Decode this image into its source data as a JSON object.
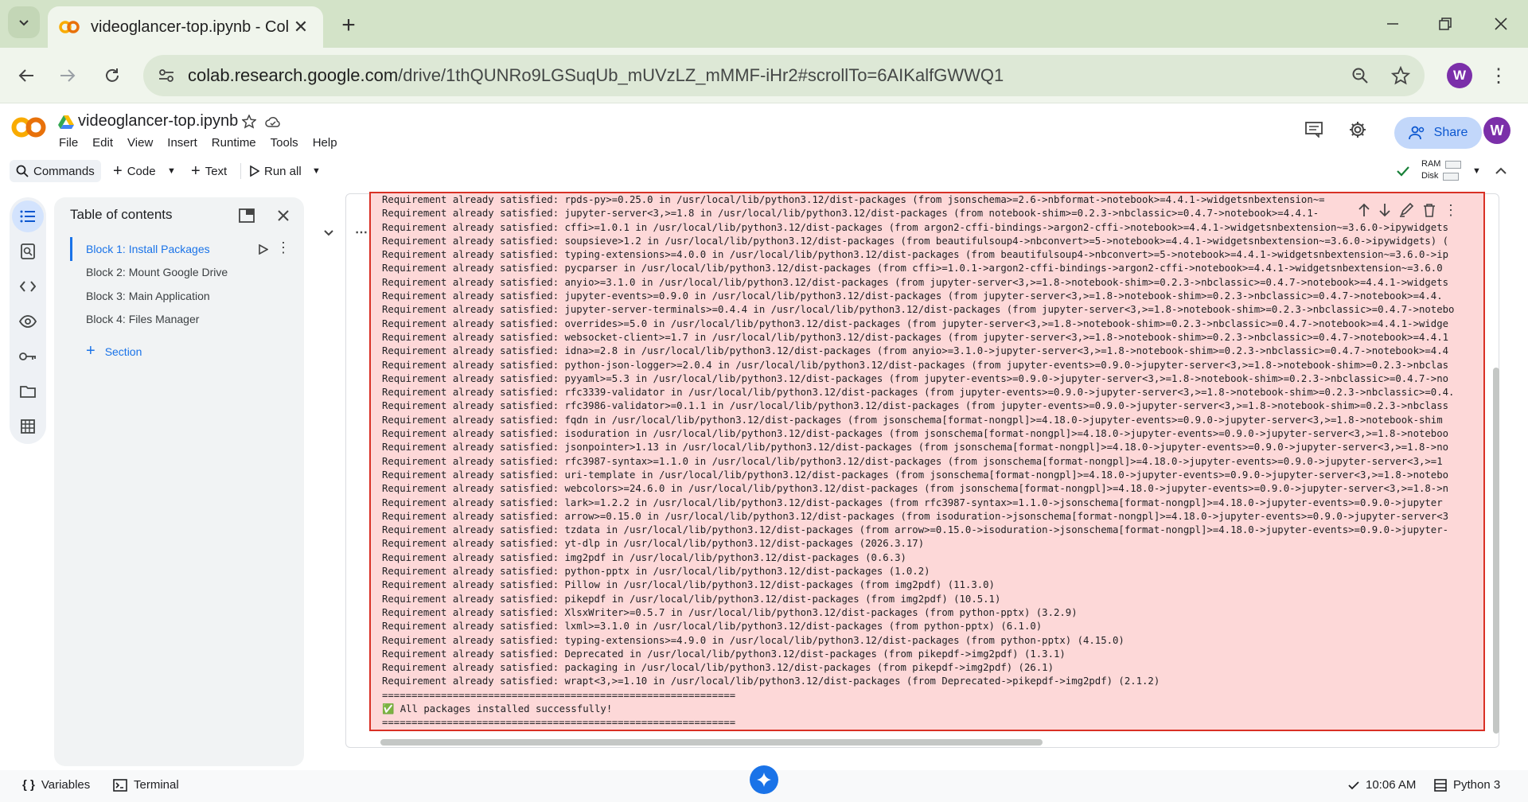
{
  "browser": {
    "tab_title": "videoglancer-top.ipynb - Colab",
    "url_host": "colab.research.google.com",
    "url_path": "/drive/1thQUNRo9LGSuqUb_mUVzLZ_mMMF-iHr2#scrollTo=6AIKalfGWWQ1",
    "profile_initial": "W"
  },
  "colab": {
    "doc_title": "videoglancer-top.ipynb",
    "menu": [
      "File",
      "Edit",
      "View",
      "Insert",
      "Runtime",
      "Tools",
      "Help"
    ],
    "share_label": "Share",
    "user_initial": "W",
    "toolbar": {
      "commands": "Commands",
      "code": "Code",
      "text": "Text",
      "run_all": "Run all",
      "ram": "RAM",
      "disk": "Disk"
    }
  },
  "toc": {
    "title": "Table of contents",
    "items": [
      "Block 1: Install Packages",
      "Block 2: Mount Google Drive",
      "Block 3: Main Application",
      "Block 4: Files Manager"
    ],
    "add_section": "Section"
  },
  "output": {
    "lines": [
      "Requirement already satisfied: rpds-py>=0.25.0 in /usr/local/lib/python3.12/dist-packages (from jsonschema>=2.6->nbformat->notebook>=4.4.1->widgetsnbextension~=",
      "Requirement already satisfied: jupyter-server<3,>=1.8 in /usr/local/lib/python3.12/dist-packages (from notebook-shim>=0.2.3->nbclassic>=0.4.7->notebook>=4.4.1-",
      "Requirement already satisfied: cffi>=1.0.1 in /usr/local/lib/python3.12/dist-packages (from argon2-cffi-bindings->argon2-cffi->notebook>=4.4.1->widgetsnbextension~=3.6.0->ipywidgets",
      "Requirement already satisfied: soupsieve>1.2 in /usr/local/lib/python3.12/dist-packages (from beautifulsoup4->nbconvert>=5->notebook>=4.4.1->widgetsnbextension~=3.6.0->ipywidgets) (",
      "Requirement already satisfied: typing-extensions>=4.0.0 in /usr/local/lib/python3.12/dist-packages (from beautifulsoup4->nbconvert>=5->notebook>=4.4.1->widgetsnbextension~=3.6.0->ip",
      "Requirement already satisfied: pycparser in /usr/local/lib/python3.12/dist-packages (from cffi>=1.0.1->argon2-cffi-bindings->argon2-cffi->notebook>=4.4.1->widgetsnbextension~=3.6.0",
      "Requirement already satisfied: anyio>=3.1.0 in /usr/local/lib/python3.12/dist-packages (from jupyter-server<3,>=1.8->notebook-shim>=0.2.3->nbclassic>=0.4.7->notebook>=4.4.1->widgets",
      "Requirement already satisfied: jupyter-events>=0.9.0 in /usr/local/lib/python3.12/dist-packages (from jupyter-server<3,>=1.8->notebook-shim>=0.2.3->nbclassic>=0.4.7->notebook>=4.4.",
      "Requirement already satisfied: jupyter-server-terminals>=0.4.4 in /usr/local/lib/python3.12/dist-packages (from jupyter-server<3,>=1.8->notebook-shim>=0.2.3->nbclassic>=0.4.7->notebo",
      "Requirement already satisfied: overrides>=5.0 in /usr/local/lib/python3.12/dist-packages (from jupyter-server<3,>=1.8->notebook-shim>=0.2.3->nbclassic>=0.4.7->notebook>=4.4.1->widge",
      "Requirement already satisfied: websocket-client>=1.7 in /usr/local/lib/python3.12/dist-packages (from jupyter-server<3,>=1.8->notebook-shim>=0.2.3->nbclassic>=0.4.7->notebook>=4.4.1",
      "Requirement already satisfied: idna>=2.8 in /usr/local/lib/python3.12/dist-packages (from anyio>=3.1.0->jupyter-server<3,>=1.8->notebook-shim>=0.2.3->nbclassic>=0.4.7->notebook>=4.4",
      "Requirement already satisfied: python-json-logger>=2.0.4 in /usr/local/lib/python3.12/dist-packages (from jupyter-events>=0.9.0->jupyter-server<3,>=1.8->notebook-shim>=0.2.3->nbclas",
      "Requirement already satisfied: pyyaml>=5.3 in /usr/local/lib/python3.12/dist-packages (from jupyter-events>=0.9.0->jupyter-server<3,>=1.8->notebook-shim>=0.2.3->nbclassic>=0.4.7->no",
      "Requirement already satisfied: rfc3339-validator in /usr/local/lib/python3.12/dist-packages (from jupyter-events>=0.9.0->jupyter-server<3,>=1.8->notebook-shim>=0.2.3->nbclassic>=0.4.",
      "Requirement already satisfied: rfc3986-validator>=0.1.1 in /usr/local/lib/python3.12/dist-packages (from jupyter-events>=0.9.0->jupyter-server<3,>=1.8->notebook-shim>=0.2.3->nbclass",
      "Requirement already satisfied: fqdn in /usr/local/lib/python3.12/dist-packages (from jsonschema[format-nongpl]>=4.18.0->jupyter-events>=0.9.0->jupyter-server<3,>=1.8->notebook-shim",
      "Requirement already satisfied: isoduration in /usr/local/lib/python3.12/dist-packages (from jsonschema[format-nongpl]>=4.18.0->jupyter-events>=0.9.0->jupyter-server<3,>=1.8->noteboo",
      "Requirement already satisfied: jsonpointer>1.13 in /usr/local/lib/python3.12/dist-packages (from jsonschema[format-nongpl]>=4.18.0->jupyter-events>=0.9.0->jupyter-server<3,>=1.8->no",
      "Requirement already satisfied: rfc3987-syntax>=1.1.0 in /usr/local/lib/python3.12/dist-packages (from jsonschema[format-nongpl]>=4.18.0->jupyter-events>=0.9.0->jupyter-server<3,>=1",
      "Requirement already satisfied: uri-template in /usr/local/lib/python3.12/dist-packages (from jsonschema[format-nongpl]>=4.18.0->jupyter-events>=0.9.0->jupyter-server<3,>=1.8->notebo",
      "Requirement already satisfied: webcolors>=24.6.0 in /usr/local/lib/python3.12/dist-packages (from jsonschema[format-nongpl]>=4.18.0->jupyter-events>=0.9.0->jupyter-server<3,>=1.8->n",
      "Requirement already satisfied: lark>=1.2.2 in /usr/local/lib/python3.12/dist-packages (from rfc3987-syntax>=1.1.0->jsonschema[format-nongpl]>=4.18.0->jupyter-events>=0.9.0->jupyter",
      "Requirement already satisfied: arrow>=0.15.0 in /usr/local/lib/python3.12/dist-packages (from isoduration->jsonschema[format-nongpl]>=4.18.0->jupyter-events>=0.9.0->jupyter-server<3",
      "Requirement already satisfied: tzdata in /usr/local/lib/python3.12/dist-packages (from arrow>=0.15.0->isoduration->jsonschema[format-nongpl]>=4.18.0->jupyter-events>=0.9.0->jupyter-",
      "Requirement already satisfied: yt-dlp in /usr/local/lib/python3.12/dist-packages (2026.3.17)",
      "Requirement already satisfied: img2pdf in /usr/local/lib/python3.12/dist-packages (0.6.3)",
      "Requirement already satisfied: python-pptx in /usr/local/lib/python3.12/dist-packages (1.0.2)",
      "Requirement already satisfied: Pillow in /usr/local/lib/python3.12/dist-packages (from img2pdf) (11.3.0)",
      "Requirement already satisfied: pikepdf in /usr/local/lib/python3.12/dist-packages (from img2pdf) (10.5.1)",
      "Requirement already satisfied: XlsxWriter>=0.5.7 in /usr/local/lib/python3.12/dist-packages (from python-pptx) (3.2.9)",
      "Requirement already satisfied: lxml>=3.1.0 in /usr/local/lib/python3.12/dist-packages (from python-pptx) (6.1.0)",
      "Requirement already satisfied: typing-extensions>=4.9.0 in /usr/local/lib/python3.12/dist-packages (from python-pptx) (4.15.0)",
      "Requirement already satisfied: Deprecated in /usr/local/lib/python3.12/dist-packages (from pikepdf->img2pdf) (1.3.1)",
      "Requirement already satisfied: packaging in /usr/local/lib/python3.12/dist-packages (from pikepdf->img2pdf) (26.1)",
      "Requirement already satisfied: wrapt<3,>=1.10 in /usr/local/lib/python3.12/dist-packages (from Deprecated->pikepdf->img2pdf) (2.1.2)",
      "============================================================",
      "✅ All packages installed successfully!",
      "============================================================"
    ]
  },
  "statusbar": {
    "variables": "Variables",
    "terminal": "Terminal",
    "time": "10:06 AM",
    "runtime": "Python 3"
  },
  "colors": {
    "tab_strip": "#d3e3c8",
    "output_bg": "#fdd8d8",
    "output_border": "#d93025",
    "accent": "#1a73e8"
  }
}
